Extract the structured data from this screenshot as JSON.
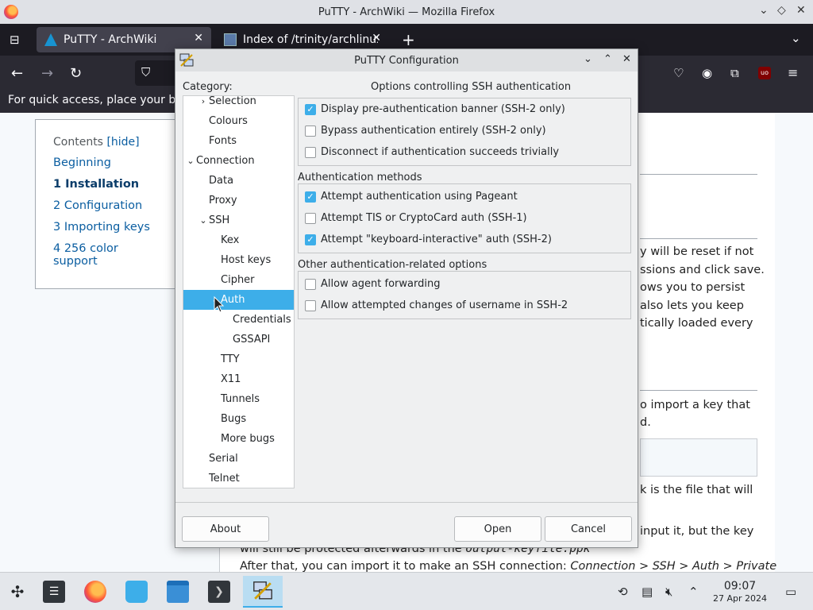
{
  "firefox": {
    "title": "PuTTY - ArchWiki — Mozilla Firefox",
    "tabs": [
      {
        "label": "PuTTY - ArchWiki"
      },
      {
        "label": "Index of /trinity/archlinux"
      }
    ],
    "bookmarks_hint": "For quick access, place your bo"
  },
  "page": {
    "toc": {
      "title": "Contents",
      "hide": "[hide]",
      "items": [
        {
          "label": "Beginning"
        },
        {
          "label": "1  Installation"
        },
        {
          "label": "2  Configuration"
        },
        {
          "label": "3  Importing keys"
        },
        {
          "label": "4  256 color support"
        }
      ]
    },
    "fragments": [
      "y will be reset if not",
      "ssions and click save.",
      "ows you to persist",
      "also lets you keep",
      "tically loaded every",
      "o import a key that",
      "d.",
      "k  is the file that will",
      "input it, but the key",
      "will still be protected afterwards in the",
      "output-keyfile.ppk",
      "After that, you can import it to make an SSH connection:",
      "Connection > SSH > Auth > Private"
    ]
  },
  "dialog": {
    "title": "PuTTY Configuration",
    "category_label": "Category:",
    "tree": [
      {
        "label": "Selection",
        "indent": 1,
        "chev": "›"
      },
      {
        "label": "Colours",
        "indent": 1,
        "chev": ""
      },
      {
        "label": "Fonts",
        "indent": 1,
        "chev": ""
      },
      {
        "label": "Connection",
        "indent": 0,
        "chev": "⌄"
      },
      {
        "label": "Data",
        "indent": 1,
        "chev": ""
      },
      {
        "label": "Proxy",
        "indent": 1,
        "chev": ""
      },
      {
        "label": "SSH",
        "indent": 1,
        "chev": "⌄"
      },
      {
        "label": "Kex",
        "indent": 2,
        "chev": ""
      },
      {
        "label": "Host keys",
        "indent": 2,
        "chev": ""
      },
      {
        "label": "Cipher",
        "indent": 2,
        "chev": ""
      },
      {
        "label": "Auth",
        "indent": 2,
        "chev": "⌄",
        "selected": true
      },
      {
        "label": "Credentials",
        "indent": 3,
        "chev": ""
      },
      {
        "label": "GSSAPI",
        "indent": 3,
        "chev": ""
      },
      {
        "label": "TTY",
        "indent": 2,
        "chev": ""
      },
      {
        "label": "X11",
        "indent": 2,
        "chev": ""
      },
      {
        "label": "Tunnels",
        "indent": 2,
        "chev": ""
      },
      {
        "label": "Bugs",
        "indent": 2,
        "chev": ""
      },
      {
        "label": "More bugs",
        "indent": 2,
        "chev": ""
      },
      {
        "label": "Serial",
        "indent": 1,
        "chev": ""
      },
      {
        "label": "Telnet",
        "indent": 1,
        "chev": ""
      }
    ],
    "options_header": "Options controlling SSH authentication",
    "group1": {
      "items": [
        {
          "label": "Display pre-authentication banner (SSH-2 only)",
          "checked": true
        },
        {
          "label": "Bypass authentication entirely (SSH-2 only)",
          "checked": false
        },
        {
          "label": "Disconnect if authentication succeeds trivially",
          "checked": false
        }
      ]
    },
    "group2": {
      "label": "Authentication methods",
      "items": [
        {
          "label": "Attempt authentication using Pageant",
          "checked": true
        },
        {
          "label": "Attempt TIS or CryptoCard auth (SSH-1)",
          "checked": false
        },
        {
          "label": "Attempt \"keyboard-interactive\" auth (SSH-2)",
          "checked": true
        }
      ]
    },
    "group3": {
      "label": "Other authentication-related options",
      "items": [
        {
          "label": "Allow agent forwarding",
          "checked": false
        },
        {
          "label": "Allow attempted changes of username in SSH-2",
          "checked": false
        }
      ]
    },
    "buttons": {
      "about": "About",
      "open": "Open",
      "cancel": "Cancel"
    }
  },
  "taskbar": {
    "time": "09:07",
    "date": "27 Apr 2024"
  },
  "colors": {
    "accent": "#3daee9",
    "link": "#0b5ea1"
  }
}
